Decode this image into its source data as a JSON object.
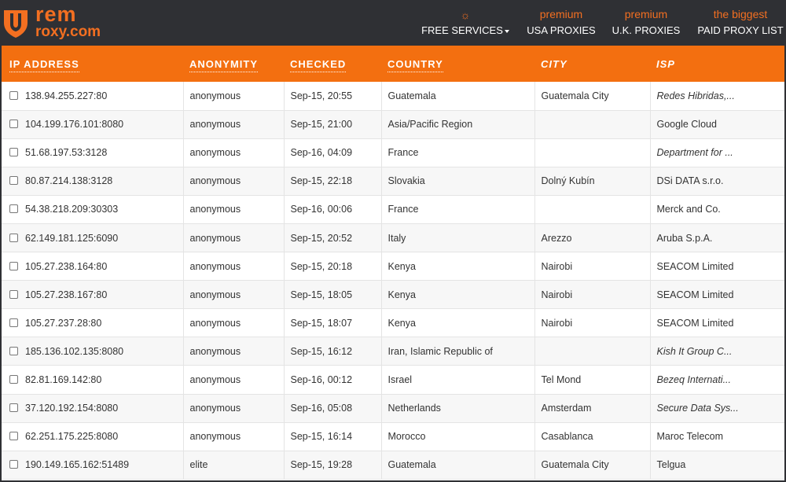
{
  "brand": {
    "top": "rem",
    "bottom_prefix": "roxy",
    "bottom_suffix": ".com",
    "colors": {
      "accent": "#f36f21",
      "nav_bg": "#2f3034"
    }
  },
  "nav": [
    {
      "top": "☼",
      "label": "FREE SERVICES",
      "has_caret": true
    },
    {
      "top": "premium",
      "label": "USA PROXIES"
    },
    {
      "top": "premium",
      "label": "U.K. PROXIES"
    },
    {
      "top": "the biggest",
      "label": "PAID PROXY LIST"
    }
  ],
  "table": {
    "headers": [
      "IP ADDRESS",
      "ANONYMITY",
      "CHECKED",
      "COUNTRY",
      "CITY",
      "ISP"
    ],
    "rows": [
      {
        "ip": "138.94.255.227:80",
        "anonymity": "anonymous",
        "checked": "Sep-15, 20:55",
        "country": "Guatemala",
        "city": "Guatemala City",
        "isp": "Redes Hibridas,...",
        "isp_italic": true
      },
      {
        "ip": "104.199.176.101:8080",
        "anonymity": "anonymous",
        "checked": "Sep-15, 21:00",
        "country": "Asia/Pacific Region",
        "city": "",
        "isp": "Google Cloud",
        "isp_italic": false
      },
      {
        "ip": "51.68.197.53:3128",
        "anonymity": "anonymous",
        "checked": "Sep-16, 04:09",
        "country": "France",
        "city": "",
        "isp": "Department for ...",
        "isp_italic": true
      },
      {
        "ip": "80.87.214.138:3128",
        "anonymity": "anonymous",
        "checked": "Sep-15, 22:18",
        "country": "Slovakia",
        "city": "Dolný Kubín",
        "isp": "DSi DATA s.r.o.",
        "isp_italic": false
      },
      {
        "ip": "54.38.218.209:30303",
        "anonymity": "anonymous",
        "checked": "Sep-16, 00:06",
        "country": "France",
        "city": "",
        "isp": "Merck and Co.",
        "isp_italic": false
      },
      {
        "ip": "62.149.181.125:6090",
        "anonymity": "anonymous",
        "checked": "Sep-15, 20:52",
        "country": "Italy",
        "city": "Arezzo",
        "isp": "Aruba S.p.A.",
        "isp_italic": false
      },
      {
        "ip": "105.27.238.164:80",
        "anonymity": "anonymous",
        "checked": "Sep-15, 20:18",
        "country": "Kenya",
        "city": "Nairobi",
        "isp": "SEACOM Limited",
        "isp_italic": false
      },
      {
        "ip": "105.27.238.167:80",
        "anonymity": "anonymous",
        "checked": "Sep-15, 18:05",
        "country": "Kenya",
        "city": "Nairobi",
        "isp": "SEACOM Limited",
        "isp_italic": false
      },
      {
        "ip": "105.27.237.28:80",
        "anonymity": "anonymous",
        "checked": "Sep-15, 18:07",
        "country": "Kenya",
        "city": "Nairobi",
        "isp": "SEACOM Limited",
        "isp_italic": false
      },
      {
        "ip": "185.136.102.135:8080",
        "anonymity": "anonymous",
        "checked": "Sep-15, 16:12",
        "country": "Iran, Islamic Republic of",
        "city": "",
        "isp": "Kish It Group C...",
        "isp_italic": true
      },
      {
        "ip": "82.81.169.142:80",
        "anonymity": "anonymous",
        "checked": "Sep-16, 00:12",
        "country": "Israel",
        "city": "Tel Mond",
        "isp": "Bezeq Internati...",
        "isp_italic": true
      },
      {
        "ip": "37.120.192.154:8080",
        "anonymity": "anonymous",
        "checked": "Sep-16, 05:08",
        "country": "Netherlands",
        "city": "Amsterdam",
        "isp": "Secure Data Sys...",
        "isp_italic": true
      },
      {
        "ip": "62.251.175.225:8080",
        "anonymity": "anonymous",
        "checked": "Sep-15, 16:14",
        "country": "Morocco",
        "city": "Casablanca",
        "isp": "Maroc Telecom",
        "isp_italic": false
      },
      {
        "ip": "190.149.165.162:51489",
        "anonymity": "elite",
        "checked": "Sep-15, 19:28",
        "country": "Guatemala",
        "city": "Guatemala City",
        "isp": "Telgua",
        "isp_italic": false
      }
    ]
  }
}
